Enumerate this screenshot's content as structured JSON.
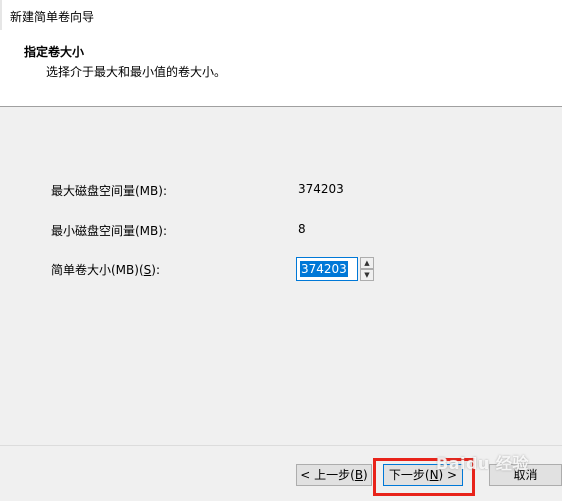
{
  "window": {
    "title": "新建简单卷向导"
  },
  "header": {
    "title": "指定卷大小",
    "subtitle": "选择介于最大和最小值的卷大小。"
  },
  "fields": {
    "max_label": "最大磁盘空间量(MB):",
    "max_value": "374203",
    "min_label": "最小磁盘空间量(MB):",
    "min_value": "8",
    "size_label": "简单卷大小(MB)(S):",
    "size_value": "374203"
  },
  "buttons": {
    "back": "< 上一步(B)",
    "next": "下一步(N) >",
    "cancel": "取消"
  },
  "watermark": "Baidu 经验",
  "colors": {
    "accent": "#0078d7",
    "highlight_box": "#e8231a"
  }
}
